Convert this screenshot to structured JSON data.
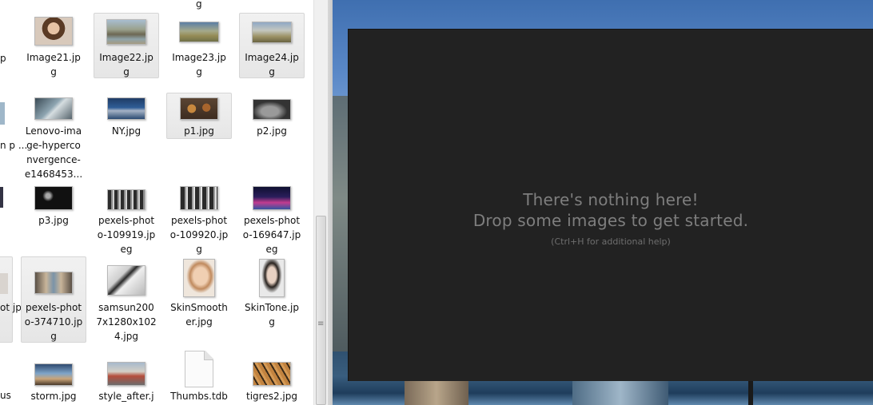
{
  "explorer": {
    "top_cut_label": "g",
    "row0": [
      {
        "name": "Image21.jpg",
        "label": "Image21.jp\ng"
      },
      {
        "name": "Image22.jpg",
        "label": "Image22.jp\ng"
      },
      {
        "name": "Image23.jpg",
        "label": "Image23.jp\ng"
      },
      {
        "name": "Image24.jpg",
        "label": "Image24.jp\ng"
      }
    ],
    "row1": [
      {
        "name": "Lenovo-image-hyperconvergence",
        "label": "Lenovo-ima\nge-hyperco\nnvergence-\ne1468453..."
      },
      {
        "name": "NY.jpg",
        "label": "NY.jpg"
      },
      {
        "name": "p1.jpg",
        "label": "p1.jpg"
      },
      {
        "name": "p2.jpg",
        "label": "p2.jpg"
      }
    ],
    "row2": [
      {
        "name": "p3.jpg",
        "label": "p3.jpg"
      },
      {
        "name": "pexels-photo-109919.jpeg",
        "label": "pexels-phot\no-109919.jp\neg"
      },
      {
        "name": "pexels-photo-109920.jpg",
        "label": "pexels-phot\no-109920.jp\ng"
      },
      {
        "name": "pexels-photo-169647.jpeg",
        "label": "pexels-phot\no-169647.jp\neg"
      }
    ],
    "row3": [
      {
        "name": "pexels-photo-374710.jpg",
        "label": "pexels-phot\no-374710.jp\ng"
      },
      {
        "name": "samsun2007x1280x1024.jpg",
        "label": "samsun200\n7x1280x102\n4.jpg"
      },
      {
        "name": "SkinSmoother.jpg",
        "label": "SkinSmooth\ner.jpg"
      },
      {
        "name": "SkinTone.jpg",
        "label": "SkinTone.jp\ng"
      }
    ],
    "row4": [
      {
        "name": "storm.jpg",
        "label": "storm.jpg"
      },
      {
        "name": "style_after.jpg",
        "label": "style_after.j"
      },
      {
        "name": "Thumbs.db",
        "label": "Thumbs.tdb"
      },
      {
        "name": "tigres2.jpg",
        "label": "tigres2.jpg"
      }
    ],
    "left_edge": {
      "r0": "\np",
      "r1": "n\np\n...",
      "r2": "",
      "r3": "ot\njp",
      "r4": "us"
    }
  },
  "app": {
    "empty_line1": "There's nothing here!",
    "empty_line2": "Drop some images to get started.",
    "help_hint": "(Ctrl+H for additional help)"
  },
  "colors": {
    "panel_bg": "#222222",
    "panel_text": "#7e7e7e",
    "selection": "#e6e6e6"
  }
}
